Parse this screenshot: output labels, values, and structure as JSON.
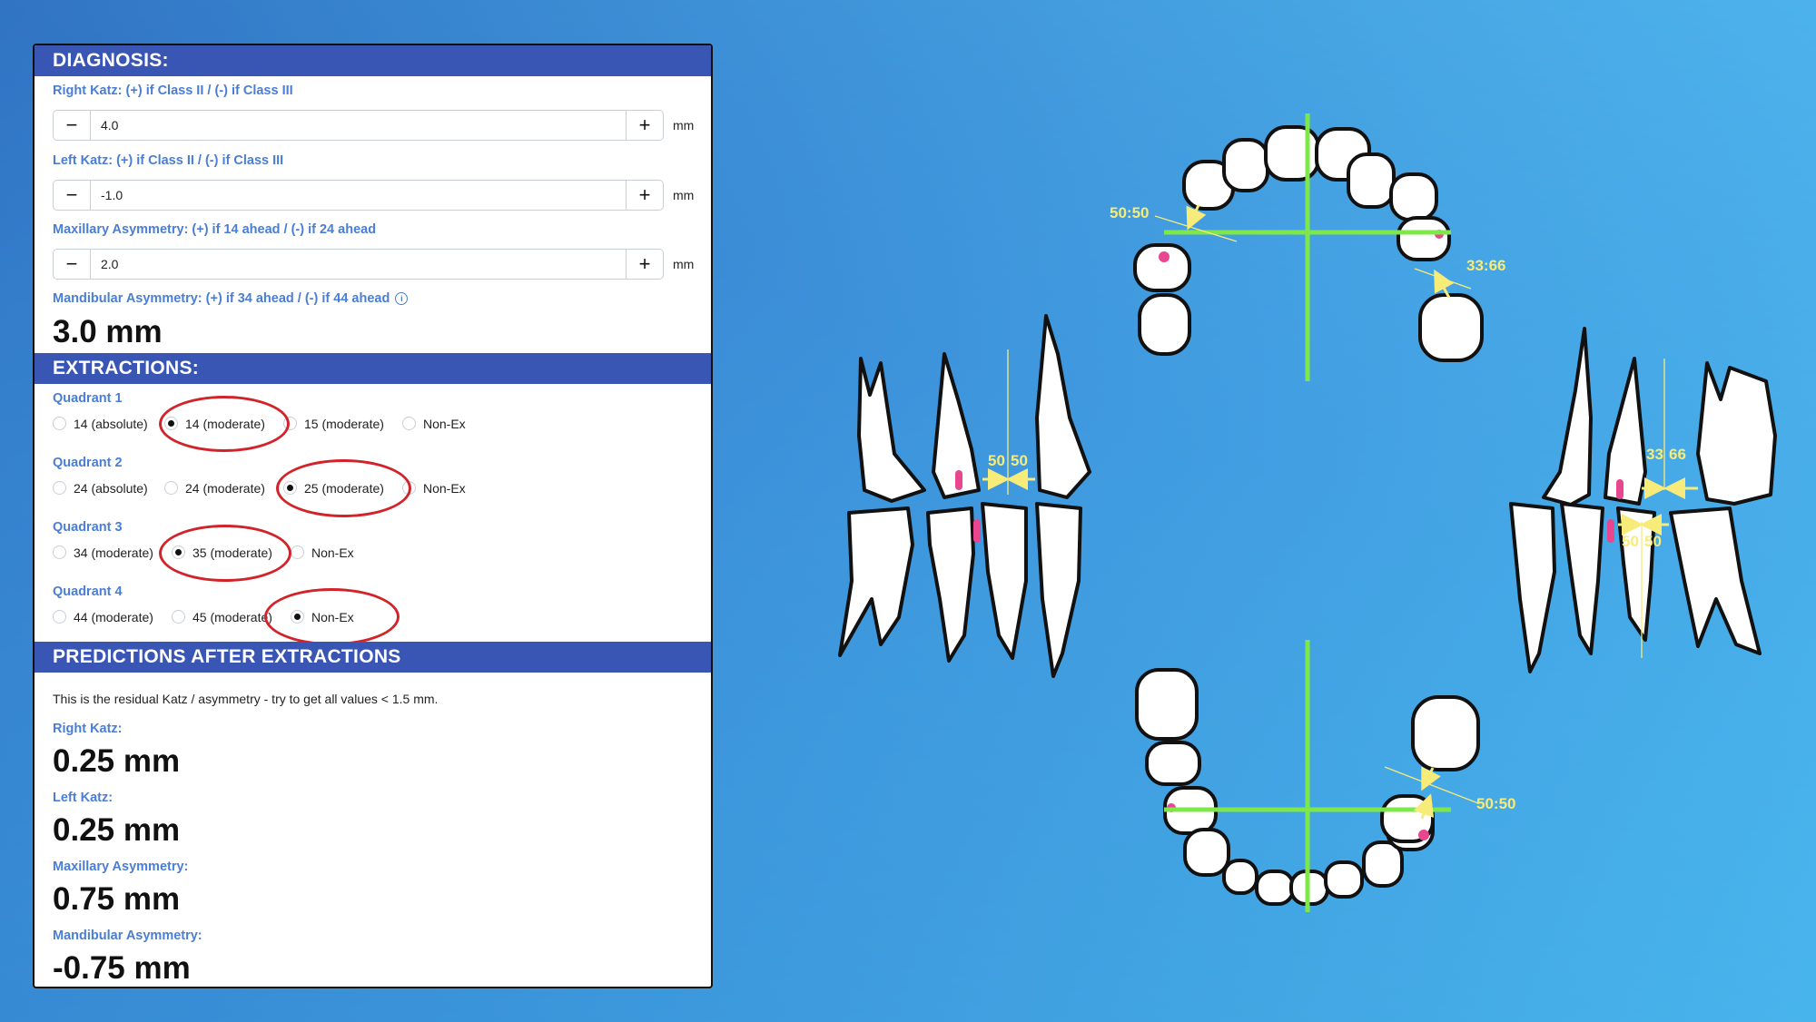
{
  "diagnosis": {
    "header": "DIAGNOSIS:",
    "right_katz": {
      "label": "Right Katz: (+) if Class II / (-) if Class III",
      "value": "4.0",
      "unit": "mm"
    },
    "left_katz": {
      "label": "Left Katz: (+) if Class II / (-) if Class III",
      "value": "-1.0",
      "unit": "mm"
    },
    "max_asym": {
      "label": "Maxillary Asymmetry: (+) if 14 ahead / (-) if 24 ahead",
      "value": "2.0",
      "unit": "mm"
    },
    "mand_asym": {
      "label": "Mandibular Asymmetry: (+) if 34 ahead / (-) if 44 ahead",
      "value": "3.0 mm"
    },
    "minus": "−",
    "plus": "+",
    "info": "i"
  },
  "extractions": {
    "header": "EXTRACTIONS:",
    "q1": {
      "label": "Quadrant 1",
      "options": [
        "14 (absolute)",
        "14 (moderate)",
        "15 (moderate)",
        "Non-Ex"
      ],
      "selected": "14 (moderate)"
    },
    "q2": {
      "label": "Quadrant 2",
      "options": [
        "24 (absolute)",
        "24 (moderate)",
        "25 (moderate)",
        "Non-Ex"
      ],
      "selected": "25 (moderate)"
    },
    "q3": {
      "label": "Quadrant 3",
      "options": [
        "34 (moderate)",
        "35 (moderate)",
        "Non-Ex"
      ],
      "selected": "35 (moderate)"
    },
    "q4": {
      "label": "Quadrant 4",
      "options": [
        "44 (moderate)",
        "45 (moderate)",
        "Non-Ex"
      ],
      "selected": "Non-Ex"
    }
  },
  "predictions": {
    "header": "PREDICTIONS AFTER EXTRACTIONS",
    "note": "This is the residual Katz / asymmetry - try to get all values < 1.5 mm.",
    "right_katz": {
      "label": "Right Katz:",
      "value": "0.25 mm"
    },
    "left_katz": {
      "label": "Left Katz:",
      "value": "0.25 mm"
    },
    "max_asym": {
      "label": "Maxillary Asymmetry:",
      "value": "0.75 mm"
    },
    "mand_asym": {
      "label": "Mandibular Asymmetry:",
      "value": "-0.75 mm"
    }
  },
  "illustration": {
    "upper_arch_left_ratio": "50:50",
    "upper_arch_right_ratio": "33:66",
    "lower_arch_ratio": "50:50",
    "left_bite_upper_left": "50",
    "left_bite_upper_right": "50",
    "right_bite_upper_left": "33",
    "right_bite_upper_right": "66",
    "right_bite_lower_left": "50",
    "right_bite_lower_right": "50"
  },
  "colors": {
    "header_bg": "#3a56b4",
    "label_blue": "#4a7ed6",
    "highlight_ring": "#d2232a",
    "midline_green": "#7ee84a",
    "annotation_yellow": "#f7eb7a",
    "marker_pink": "#e8478f"
  }
}
